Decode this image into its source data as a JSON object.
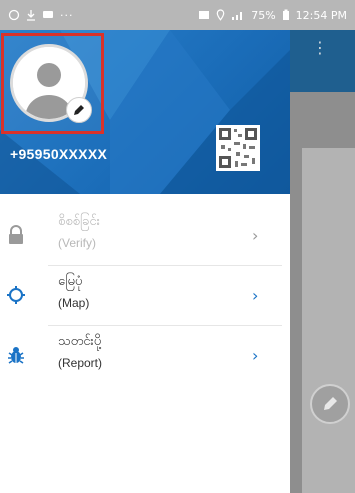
{
  "status_bar": {
    "battery": "75%",
    "time": "12:54 PM"
  },
  "profile": {
    "phone": "+95950XXXXX"
  },
  "menu": {
    "items": [
      {
        "title": "စိစစ်ခြင်း",
        "subtitle": "(Verify)",
        "icon": "lock-icon",
        "enabled": false
      },
      {
        "title": "မြေပုံ",
        "subtitle": "(Map)",
        "icon": "target-icon",
        "enabled": true
      },
      {
        "title": "သတင်းပို့",
        "subtitle": "(Report)",
        "icon": "bug-icon",
        "enabled": true
      }
    ]
  },
  "colors": {
    "header_blue": "#1b6db9",
    "accent_blue": "#1a73c6",
    "avatar_highlight": "#d9322a",
    "report_icon": "#1a73c6"
  }
}
